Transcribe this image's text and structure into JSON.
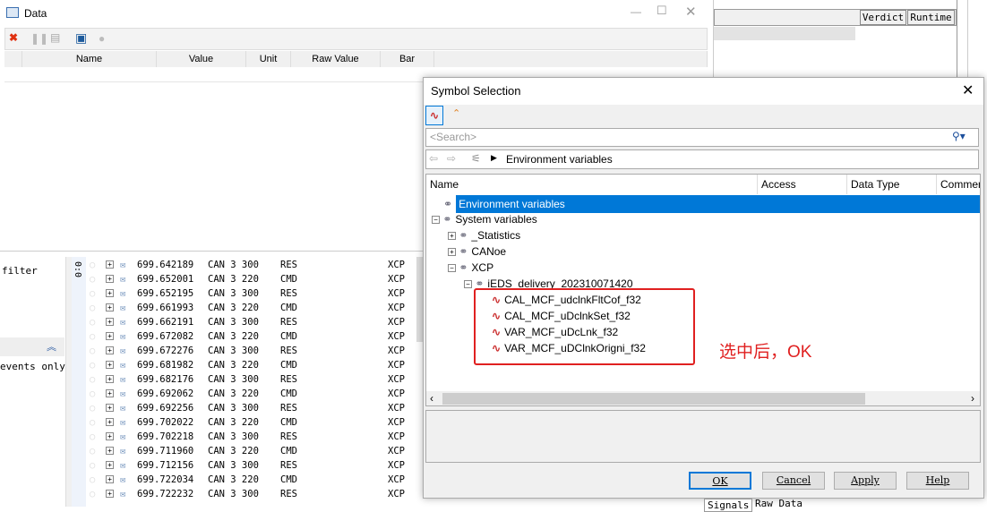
{
  "data_window": {
    "title": "Data",
    "columns": [
      "Name",
      "Value",
      "Unit",
      "Raw Value",
      "Bar"
    ]
  },
  "right_panel": {
    "columns": [
      "Verdict",
      "Runtime"
    ],
    "tabs": [
      "Signals",
      "Raw Data"
    ]
  },
  "left_panel": {
    "filter_label": "filter",
    "events_label": "events only"
  },
  "trace": {
    "col_header": "0:0",
    "rows": [
      [
        "699.642189",
        "CAN 3 300",
        "RES",
        "XCP"
      ],
      [
        "699.652001",
        "CAN 3 220",
        "CMD",
        "XCP"
      ],
      [
        "699.652195",
        "CAN 3 300",
        "RES",
        "XCP"
      ],
      [
        "699.661993",
        "CAN 3 220",
        "CMD",
        "XCP"
      ],
      [
        "699.662191",
        "CAN 3 300",
        "RES",
        "XCP"
      ],
      [
        "699.672082",
        "CAN 3 220",
        "CMD",
        "XCP"
      ],
      [
        "699.672276",
        "CAN 3 300",
        "RES",
        "XCP"
      ],
      [
        "699.681982",
        "CAN 3 220",
        "CMD",
        "XCP"
      ],
      [
        "699.682176",
        "CAN 3 300",
        "RES",
        "XCP"
      ],
      [
        "699.692062",
        "CAN 3 220",
        "CMD",
        "XCP"
      ],
      [
        "699.692256",
        "CAN 3 300",
        "RES",
        "XCP"
      ],
      [
        "699.702022",
        "CAN 3 220",
        "CMD",
        "XCP"
      ],
      [
        "699.702218",
        "CAN 3 300",
        "RES",
        "XCP"
      ],
      [
        "699.711960",
        "CAN 3 220",
        "CMD",
        "XCP"
      ],
      [
        "699.712156",
        "CAN 3 300",
        "RES",
        "XCP"
      ],
      [
        "699.722034",
        "CAN 3 220",
        "CMD",
        "XCP"
      ],
      [
        "699.722232",
        "CAN 3 300",
        "RES",
        "XCP"
      ]
    ]
  },
  "dialog": {
    "title": "Symbol Selection",
    "search_placeholder": "<Search>",
    "breadcrumb": "Environment variables",
    "columns": [
      "Name",
      "Access",
      "Data Type",
      "Commen"
    ],
    "tree": [
      {
        "label": "Environment variables",
        "level": 0,
        "selected": true,
        "toggle": ""
      },
      {
        "label": "System variables",
        "level": 0,
        "toggle": "-"
      },
      {
        "label": "_Statistics",
        "level": 1,
        "toggle": "+"
      },
      {
        "label": "CANoe",
        "level": 1,
        "toggle": "+"
      },
      {
        "label": "XCP",
        "level": 1,
        "toggle": "-"
      },
      {
        "label": "iEDS_delivery_202310071420",
        "level": 2,
        "toggle": "-"
      },
      {
        "label": "CAL_MCF_udclnkFltCof_f32",
        "level": 3,
        "toggle": "",
        "signal": true
      },
      {
        "label": "CAL_MCF_uDclnkSet_f32",
        "level": 3,
        "toggle": "",
        "signal": true
      },
      {
        "label": "VAR_MCF_uDcLnk_f32",
        "level": 3,
        "toggle": "",
        "signal": true
      },
      {
        "label": "VAR_MCF_uDClnkOrigni_f32",
        "level": 3,
        "toggle": "",
        "signal": true
      }
    ],
    "buttons": {
      "ok": "OK",
      "cancel": "Cancel",
      "apply": "Apply",
      "help": "Help"
    }
  },
  "annotation": {
    "text": "选中后，OK",
    "color": "#e02020"
  },
  "colors": {
    "selection": "#0078d7",
    "annotation": "#e02020"
  }
}
